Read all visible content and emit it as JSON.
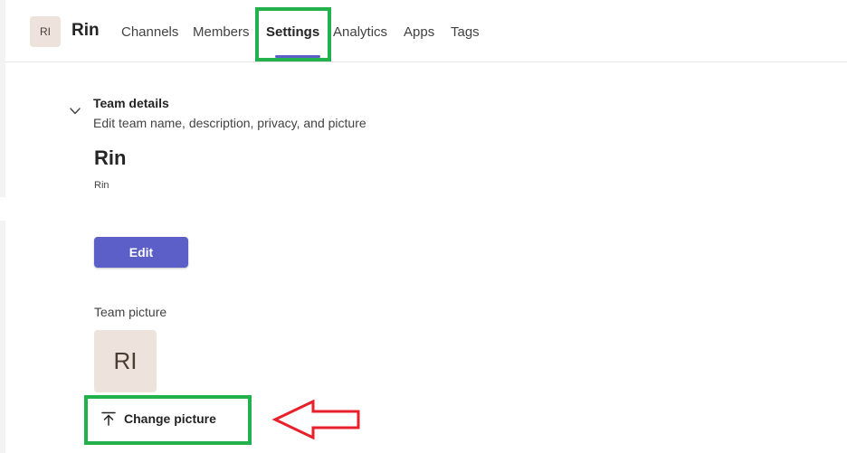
{
  "header": {
    "avatar_initials": "RI",
    "team_name": "Rin",
    "tabs": [
      {
        "label": "Channels"
      },
      {
        "label": "Members"
      },
      {
        "label": "Settings"
      },
      {
        "label": "Analytics"
      },
      {
        "label": "Apps"
      },
      {
        "label": "Tags"
      }
    ],
    "active_tab": "Settings"
  },
  "team_details": {
    "title": "Team details",
    "subtitle": "Edit team name, description, privacy, and picture",
    "name": "Rin",
    "description": "Rin",
    "edit_label": "Edit"
  },
  "team_picture": {
    "label": "Team picture",
    "initials": "RI",
    "change_label": "Change picture"
  },
  "colors": {
    "accent": "#5b5fc7",
    "highlight": "#22b14c",
    "arrow": "#e8202a",
    "avatar_bg": "#ede3dc"
  },
  "icons": {
    "chevron": "chevron-down-icon",
    "upload": "upload-icon",
    "annotation_arrow": "arrow-left-icon"
  }
}
